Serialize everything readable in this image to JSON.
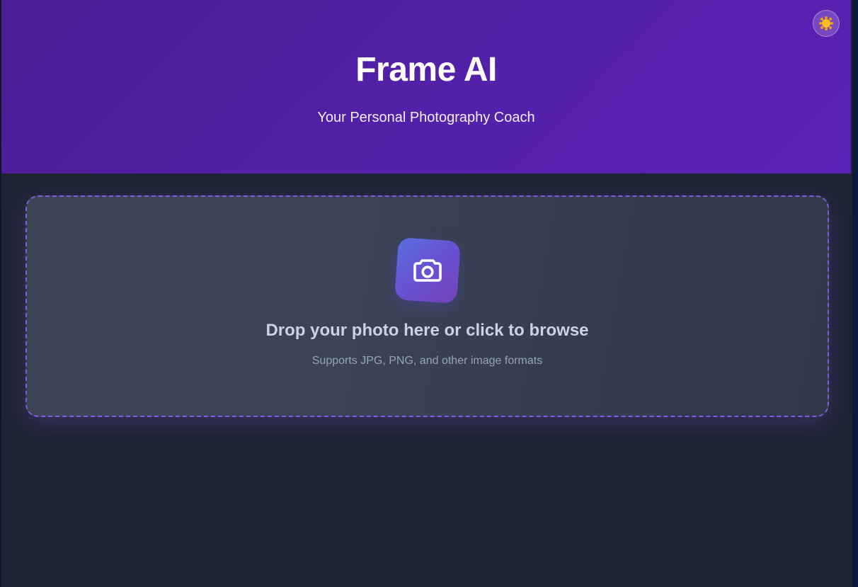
{
  "header": {
    "title": "Frame AI",
    "subtitle": "Your Personal Photography Coach",
    "theme_toggle_icon": "sun-icon"
  },
  "upload": {
    "icon": "camera-icon",
    "title": "Drop your photo here or click to browse",
    "subtitle": "Supports JPG, PNG, and other image formats"
  },
  "colors": {
    "header_gradient_start": "#4c1d95",
    "header_gradient_end": "#5b21b6",
    "background": "#1e2433",
    "dropzone_border": "#7c5ce0",
    "accent_gradient_start": "#5a6fe0",
    "accent_gradient_end": "#7443b8"
  }
}
